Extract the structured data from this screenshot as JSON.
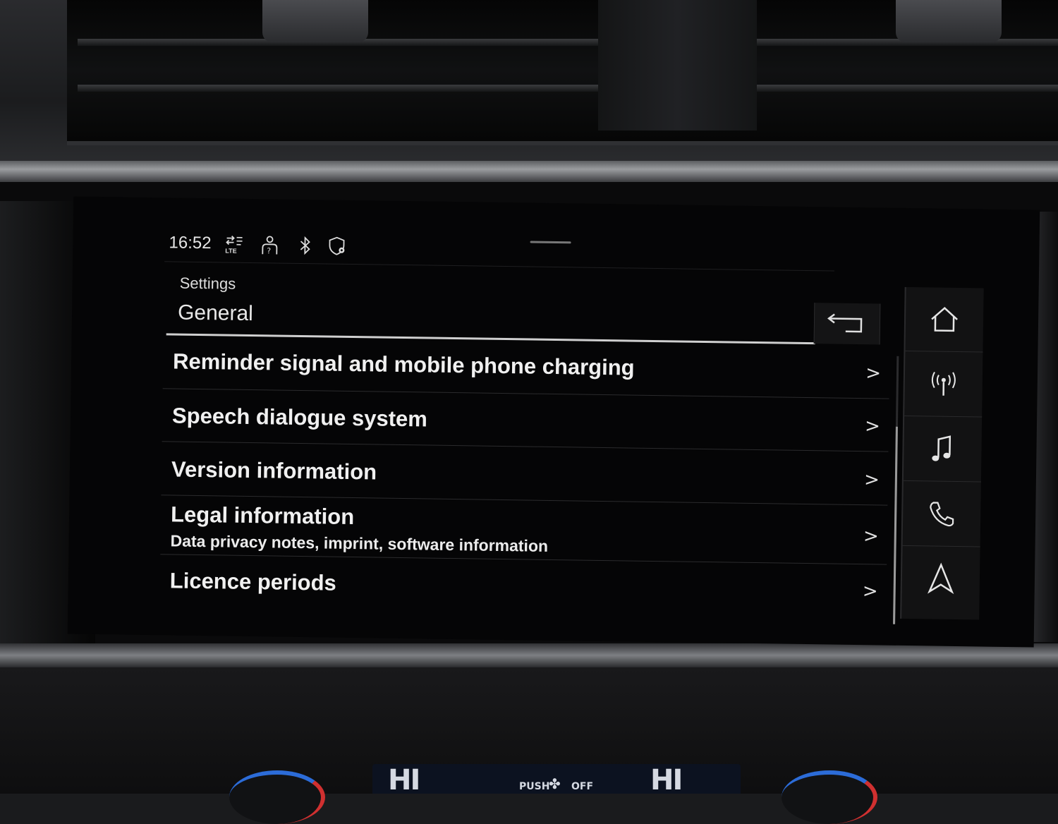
{
  "status_bar": {
    "time": "16:52",
    "icons": [
      "lte-data-icon",
      "person-help-icon",
      "bluetooth-icon",
      "location-shield-icon"
    ]
  },
  "header": {
    "breadcrumb": "Settings",
    "title": "General",
    "back_icon": "back-arrow-icon"
  },
  "menu": {
    "items": [
      {
        "label": "Reminder signal and mobile phone charging",
        "sub": ""
      },
      {
        "label": "Speech dialogue system",
        "sub": ""
      },
      {
        "label": "Version information",
        "sub": ""
      },
      {
        "label": "Legal information",
        "sub": "Data privacy notes, imprint, software information"
      },
      {
        "label": "Licence periods",
        "sub": ""
      }
    ],
    "chevron": ">"
  },
  "side_nav": {
    "items": [
      "home-icon",
      "radio-icon",
      "music-icon",
      "phone-icon",
      "navigation-icon"
    ]
  },
  "climate": {
    "left_temp": "HI",
    "right_temp": "HI",
    "push_label": "PUSH",
    "off_label": "OFF"
  },
  "colors": {
    "screen_bg": "#050506",
    "text": "#f0f0f0",
    "divider": "#2b2b2d"
  }
}
